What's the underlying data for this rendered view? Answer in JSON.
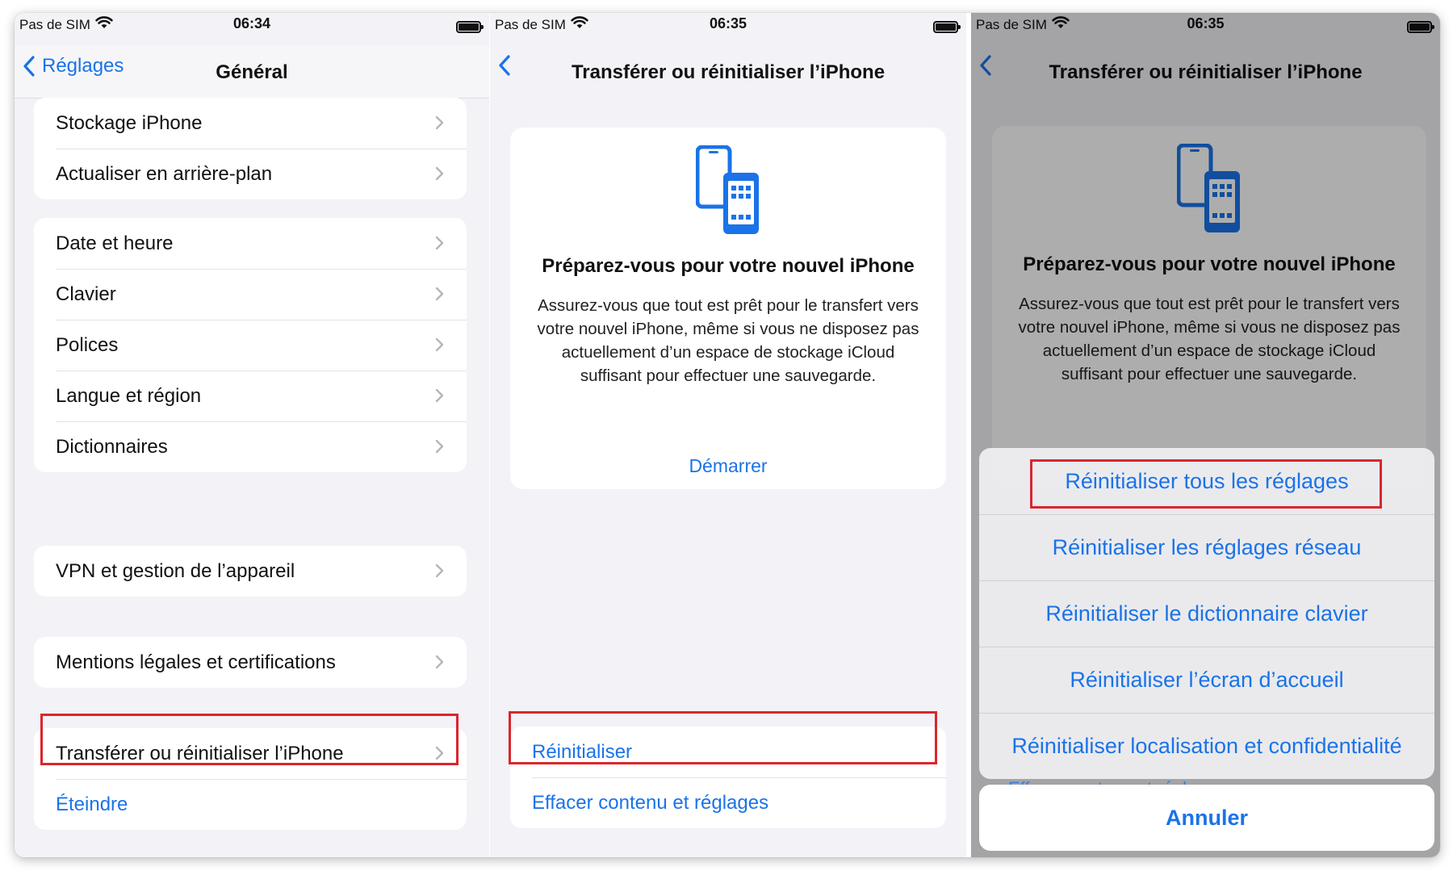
{
  "colors": {
    "accent": "#1a73e8",
    "highlight": "#d9262c",
    "background": "#f2f2f7"
  },
  "status": {
    "carrier": "Pas de SIM",
    "times": [
      "06:34",
      "06:35",
      "06:35"
    ]
  },
  "panel1": {
    "back_label": "Réglages",
    "title": "Général",
    "groups": [
      [
        "Stockage iPhone",
        "Actualiser en arrière-plan"
      ],
      [
        "Date et heure",
        "Clavier",
        "Polices",
        "Langue et région",
        "Dictionnaires"
      ],
      [
        "VPN et gestion de l’appareil"
      ],
      [
        "Mentions légales et certifications"
      ]
    ],
    "transfer_label": "Transférer ou réinitialiser l’iPhone",
    "shutdown_label": "Éteindre"
  },
  "panel2": {
    "title": "Transférer ou réinitialiser l’iPhone",
    "card_title": "Préparez-vous pour votre nouvel iPhone",
    "card_body": "Assurez-vous que tout est prêt pour le transfert vers votre nouvel iPhone, même si vous ne disposez pas actuellement d’un espace de stockage iCloud suffisant pour effectuer une sauvegarde.",
    "start_label": "Démarrer",
    "reset_label": "Réinitialiser",
    "erase_label": "Effacer contenu et réglages"
  },
  "panel3": {
    "title": "Transférer ou réinitialiser l’iPhone",
    "card_title": "Préparez-vous pour votre nouvel iPhone",
    "card_body": "Assurez-vous que tout est prêt pour le transfert vers votre nouvel iPhone, même si vous ne disposez pas actuellement d’un espace de stockage iCloud suffisant pour effectuer une sauvegarde.",
    "sheet_options": [
      "Réinitialiser tous les réglages",
      "Réinitialiser les réglages réseau",
      "Réinitialiser le dictionnaire clavier",
      "Réinitialiser l’écran d’accueil",
      "Réinitialiser localisation et confidentialité"
    ],
    "sheet_peek": "Effacer contenu et réglages",
    "cancel_label": "Annuler"
  },
  "icons": [
    "chevron-left-icon",
    "chevron-right-icon",
    "wifi-icon",
    "battery-icon",
    "transfer-phones-icon"
  ]
}
